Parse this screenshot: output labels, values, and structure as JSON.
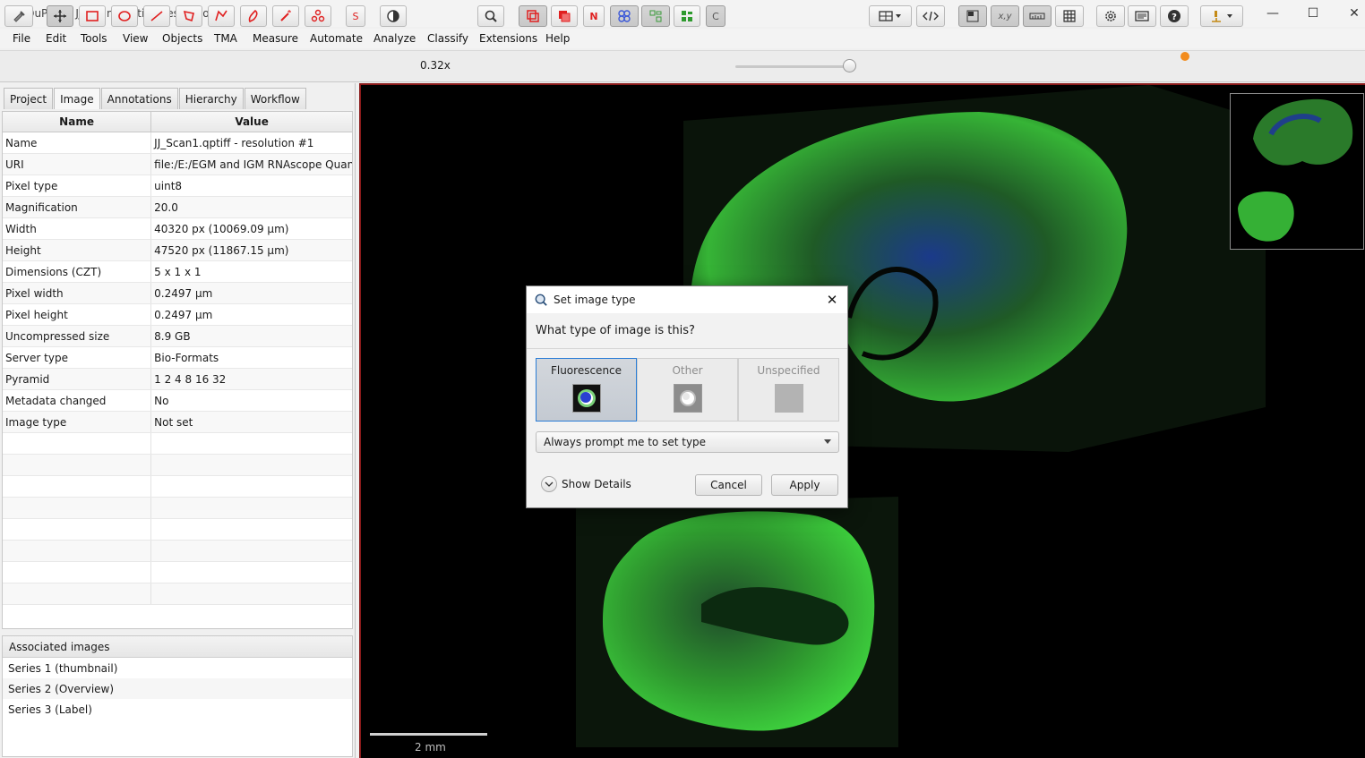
{
  "window": {
    "title": "QuPath - JJ_Scan1.qptiff - resolution #1",
    "minimize": "—",
    "maximize": "☐",
    "close": "✕"
  },
  "menu": [
    "File",
    "Edit",
    "Tools",
    "View",
    "Objects",
    "TMA",
    "Measure",
    "Automate",
    "Analyze",
    "Classify",
    "Extensions",
    "Help"
  ],
  "toolbar": {
    "zoom": "0.32x",
    "s_label": "S",
    "n_label": "N",
    "c_label": "C",
    "xy_label": "x,y"
  },
  "tabs": [
    "Project",
    "Image",
    "Annotations",
    "Hierarchy",
    "Workflow"
  ],
  "table": {
    "headers": [
      "Name",
      "Value"
    ],
    "rows": [
      [
        "Name",
        "JJ_Scan1.qptiff - resolution #1"
      ],
      [
        "URI",
        "file:/E:/EGM and IGM RNAscope Quanti..."
      ],
      [
        "Pixel type",
        "uint8"
      ],
      [
        "Magnification",
        "20.0"
      ],
      [
        "Width",
        "40320 px (10069.09 μm)"
      ],
      [
        "Height",
        "47520 px (11867.15 μm)"
      ],
      [
        "Dimensions (CZT)",
        "5 x 1 x 1"
      ],
      [
        "Pixel width",
        "0.2497 μm"
      ],
      [
        "Pixel height",
        "0.2497 μm"
      ],
      [
        "Uncompressed size",
        "8.9 GB"
      ],
      [
        "Server type",
        "Bio-Formats"
      ],
      [
        "Pyramid",
        "1 2 4 8 16 32"
      ],
      [
        "Metadata changed",
        "No"
      ],
      [
        "Image type",
        "Not set"
      ]
    ]
  },
  "associated": {
    "title": "Associated images",
    "items": [
      "Series 1 (thumbnail)",
      "Series 2 (Overview)",
      "Series 3 (Label)"
    ]
  },
  "viewer": {
    "scale": "2 mm"
  },
  "dialog": {
    "title": "Set image type",
    "question": "What type of image is this?",
    "options": [
      "Fluorescence",
      "Other",
      "Unspecified"
    ],
    "selected": "Fluorescence",
    "prompt": "Always prompt me to set type",
    "details": "Show Details",
    "cancel": "Cancel",
    "apply": "Apply"
  },
  "colors": {
    "accent": "#2a7dd6",
    "tool_red": "#e02020",
    "tissue_green": "#2fbf2f",
    "notification": "#f28c1e"
  }
}
